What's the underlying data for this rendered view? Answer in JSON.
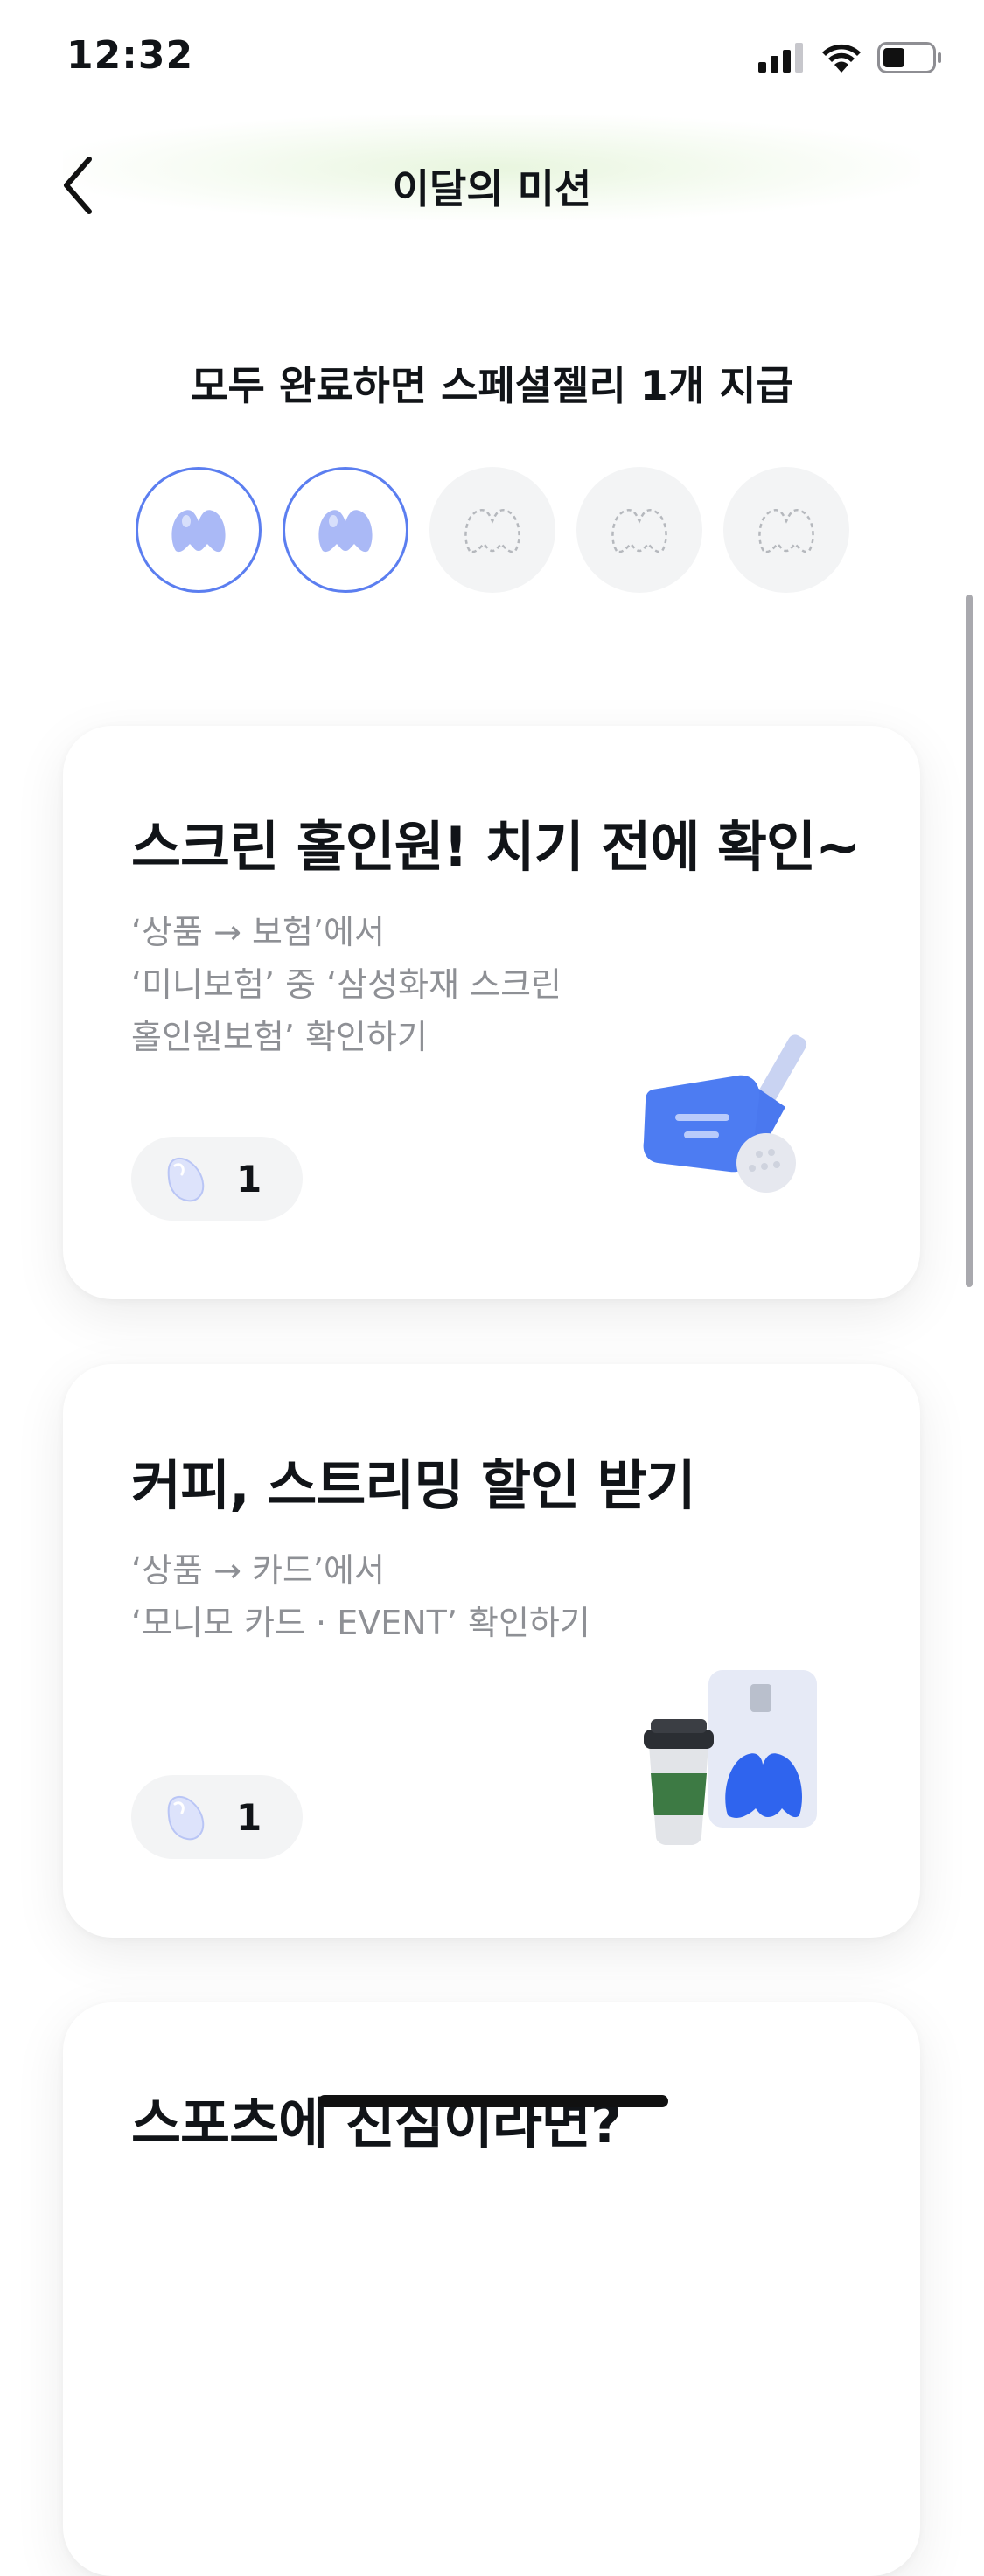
{
  "status_bar": {
    "time": "12:32"
  },
  "header": {
    "title": "이달의 미션"
  },
  "progress": {
    "title": "모두 완료하면 스페셜젤리 1개 지급",
    "slots": [
      "done",
      "done",
      "todo",
      "todo",
      "todo"
    ],
    "accent_color": "#5b7ef0"
  },
  "missions": [
    {
      "title": "스크린 홀인원! 치기 전에 확인~",
      "desc_lines": [
        "‘상품 → 보험’에서",
        "‘미니보험’ 중 ‘삼성화재 스크린",
        "홀인원보험’ 확인하기"
      ],
      "reward": "1",
      "illustration": "golf-club-icon"
    },
    {
      "title": "커피, 스트리밍 할인 받기",
      "desc_lines": [
        "‘상품 → 카드’에서",
        "‘모니모 카드 · EVENT’ 확인하기"
      ],
      "reward": "1",
      "illustration": "coffee-card-icon"
    },
    {
      "title": "스포츠에 진심이라면?"
    }
  ]
}
